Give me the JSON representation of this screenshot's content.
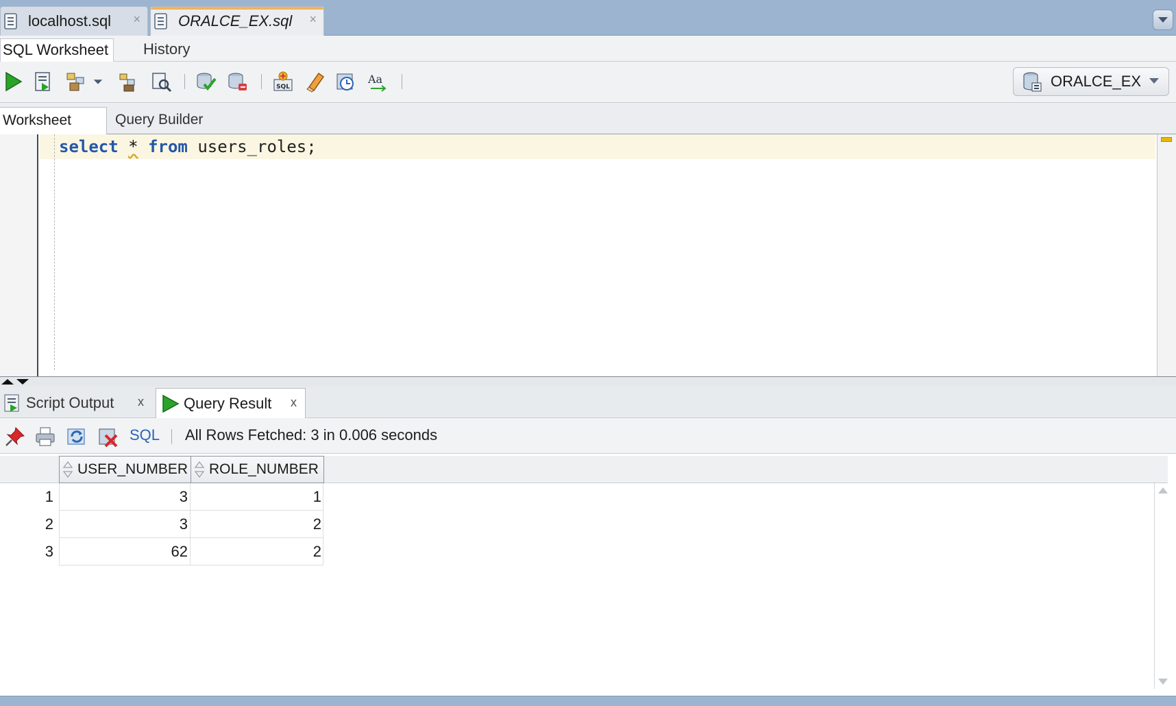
{
  "file_tabs": [
    {
      "label": "localhost.sql",
      "active": false
    },
    {
      "label": "ORALCE_EX.sql",
      "active": true
    }
  ],
  "close_glyph": "×",
  "subtabs": {
    "worksheet": "SQL Worksheet",
    "history": "History"
  },
  "connection": {
    "name": "ORALCE_EX"
  },
  "toolbar_icons": [
    "run-statement-icon",
    "run-script-icon",
    "autotrace-icon",
    "autotrace-dropdown-icon",
    "explain-plan-icon",
    "sql-tuning-icon",
    "commit-icon",
    "rollback-icon",
    "unshared-sql-icon",
    "clear-eraser-icon",
    "sql-history-icon",
    "format-case-icon"
  ],
  "editor_tabs": {
    "worksheet": "Worksheet",
    "query_builder": "Query Builder"
  },
  "editor": {
    "kw_select": "select",
    "star": "*",
    "kw_from": "from",
    "rest": "users_roles;"
  },
  "result_tabs": {
    "script_output": "Script Output",
    "query_result": "Query Result",
    "close_glyph": "x"
  },
  "result_toolbar": {
    "sql_link": "SQL",
    "status": "All Rows Fetched: 3 in 0.006 seconds"
  },
  "grid": {
    "columns": [
      "USER_NUMBER",
      "ROLE_NUMBER"
    ],
    "rows": [
      {
        "n": "1",
        "user_number": "3",
        "role_number": "1"
      },
      {
        "n": "2",
        "user_number": "3",
        "role_number": "2"
      },
      {
        "n": "3",
        "user_number": "62",
        "role_number": "2"
      }
    ]
  },
  "colors": {
    "chrome_blue": "#9cb4cf",
    "active_tab_accent": "#f3b355",
    "keyword": "#2457a8",
    "run_green": "#2aa32a"
  }
}
